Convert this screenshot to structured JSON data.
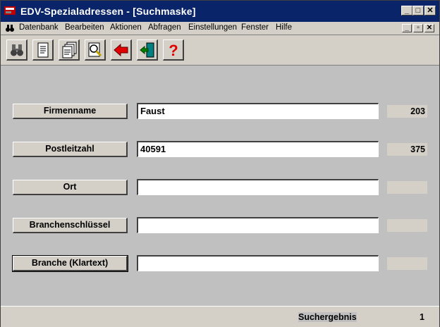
{
  "window": {
    "title": "EDV-Spezialadressen - [Suchmaske]",
    "title_bg": "#0a246a",
    "caption_buttons": {
      "minimize": "_",
      "maximize": "□",
      "close": "✕"
    }
  },
  "menubar": {
    "items": [
      "Datenbank",
      "Bearbeiten",
      "Aktionen",
      "Abfragen",
      "Einstellungen",
      "Fenster",
      "Hilfe"
    ],
    "mdi_buttons": {
      "minimize": "_",
      "restore": "▫",
      "close": "✕"
    }
  },
  "toolbar": {
    "buttons": [
      {
        "icon": "binoculars-icon"
      },
      {
        "icon": "document-icon"
      },
      {
        "icon": "documents-stack-icon"
      },
      {
        "icon": "search-document-icon"
      },
      {
        "icon": "back-arrow-icon"
      },
      {
        "icon": "exit-door-icon"
      },
      {
        "icon": "help-icon"
      }
    ]
  },
  "form": {
    "fields": [
      {
        "label": "Firmenname",
        "value": "Faust",
        "count": "203"
      },
      {
        "label": "Postleitzahl",
        "value": "40591",
        "count": "375"
      },
      {
        "label": "Ort",
        "value": "",
        "count": ""
      },
      {
        "label": "Branchenschlüssel",
        "value": "",
        "count": ""
      },
      {
        "label": "Branche (Klartext)",
        "value": "",
        "count": ""
      }
    ]
  },
  "statusbar": {
    "label": "Suchergebnis",
    "value": "1"
  }
}
